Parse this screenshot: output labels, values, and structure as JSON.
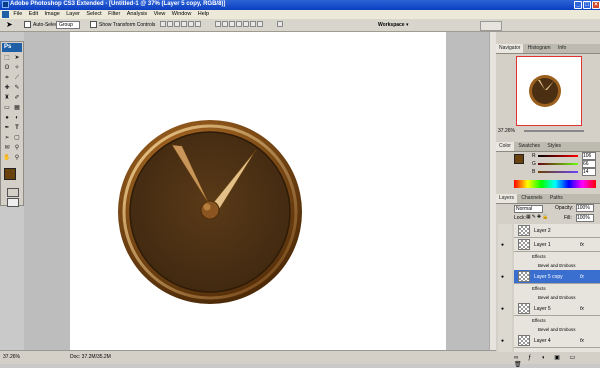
{
  "window": {
    "title": "Adobe Photoshop CS3 Extended - [Untitled-1 @ 37% (Layer 5 copy, RGB/8)]"
  },
  "menu": [
    "File",
    "Edit",
    "Image",
    "Layer",
    "Select",
    "Filter",
    "Analysis",
    "View",
    "Window",
    "Help"
  ],
  "options": {
    "auto_select_label": "Auto-Select:",
    "auto_select_value": "Group",
    "show_transform_label": "Show Transform Controls",
    "workspace_label": "Workspace"
  },
  "toolbox": {
    "badge": "Ps"
  },
  "status": {
    "zoom": "37.26%",
    "doc": "Doc: 37.2M/35.2M"
  },
  "navigator": {
    "tabs": [
      "Navigator",
      "Histogram",
      "Info"
    ],
    "zoom": "37.26%"
  },
  "color_panel": {
    "tabs": [
      "Color",
      "Swatches",
      "Styles"
    ],
    "channels": [
      {
        "label": "R",
        "value": "106"
      },
      {
        "label": "G",
        "value": "66"
      },
      {
        "label": "B",
        "value": "14"
      }
    ]
  },
  "layers_panel": {
    "tabs": [
      "Layers",
      "Channels",
      "Paths"
    ],
    "blend_mode": "Normal",
    "opacity_label": "Opacity:",
    "opacity_value": "100%",
    "lock_label": "Lock:",
    "fill_label": "Fill:",
    "fill_value": "100%",
    "rows": [
      {
        "name": "Layer 2",
        "fx": ""
      },
      {
        "name": "Layer 1",
        "fx": "fx"
      },
      {
        "name": "Layer 5 copy",
        "fx": "fx"
      },
      {
        "name": "Layer 5",
        "fx": "fx"
      },
      {
        "name": "Layer 4",
        "fx": "fx"
      }
    ],
    "effects_label": "Effects",
    "bevel_label": "Bevel and Emboss"
  },
  "colors": {
    "titlebar": "#0b3fc2",
    "foreground": "#6a420e",
    "background": "#b07a30",
    "selected_layer": "#3a6fd0"
  }
}
